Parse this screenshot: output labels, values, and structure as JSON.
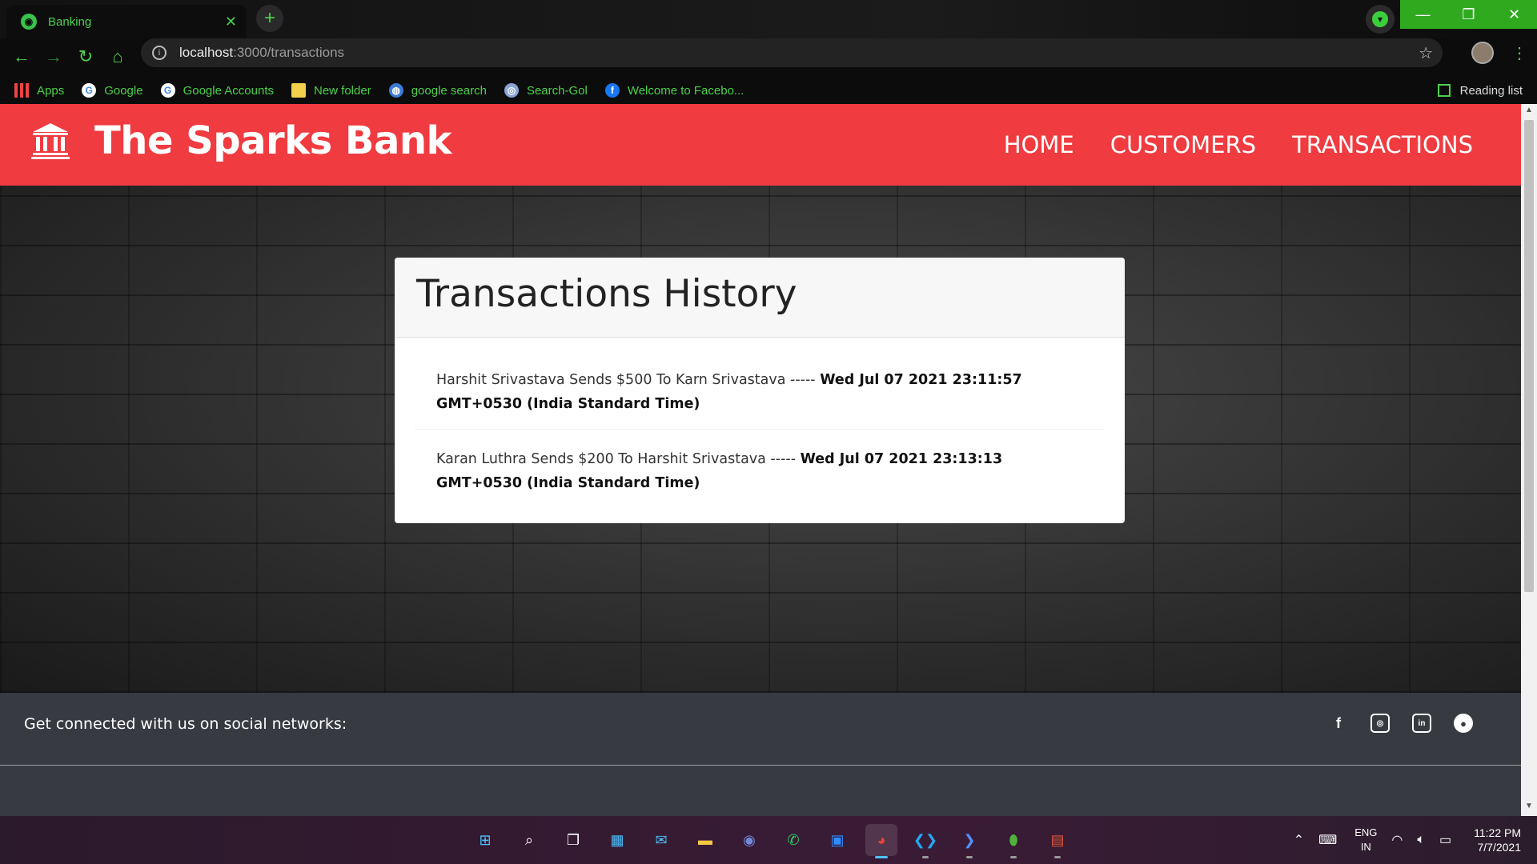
{
  "browser": {
    "tab_title": "Banking",
    "url_host": "localhost",
    "url_path": ":3000/transactions",
    "bookmarks": [
      {
        "label": "Apps",
        "icon": "apps-icon"
      },
      {
        "label": "Google",
        "icon": "google-icon"
      },
      {
        "label": "Google Accounts",
        "icon": "google-icon"
      },
      {
        "label": "New folder",
        "icon": "folder-icon"
      },
      {
        "label": "google search",
        "icon": "globe-icon"
      },
      {
        "label": "Search-Gol",
        "icon": "search-icon"
      },
      {
        "label": "Welcome to Facebo...",
        "icon": "facebook-icon"
      }
    ],
    "reading_list": "Reading list"
  },
  "navbar": {
    "brand": "The Sparks Bank",
    "links": [
      "HOME",
      "CUSTOMERS",
      "TRANSACTIONS"
    ]
  },
  "main": {
    "heading": "Transactions History",
    "transactions": [
      {
        "text": "Harshit Srivastava Sends $500 To Karn Srivastava -----",
        "time": "Wed Jul 07 2021 23:11:57 GMT+0530 (India Standard Time)"
      },
      {
        "text": "Karan Luthra Sends $200 To Harshit Srivastava -----",
        "time": "Wed Jul 07 2021 23:13:13 GMT+0530 (India Standard Time)"
      }
    ]
  },
  "footer": {
    "connect_text": "Get connected with us on social networks:",
    "socials": [
      "facebook-icon",
      "instagram-icon",
      "linkedin-icon",
      "github-icon"
    ]
  },
  "taskbar": {
    "lang_top": "ENG",
    "lang_bottom": "IN",
    "time": "11:22 PM",
    "date": "7/7/2021"
  },
  "colors": {
    "brand_red": "#f03b40",
    "footer_bg": "#373b41",
    "chrome_accent": "#4ad14a"
  }
}
